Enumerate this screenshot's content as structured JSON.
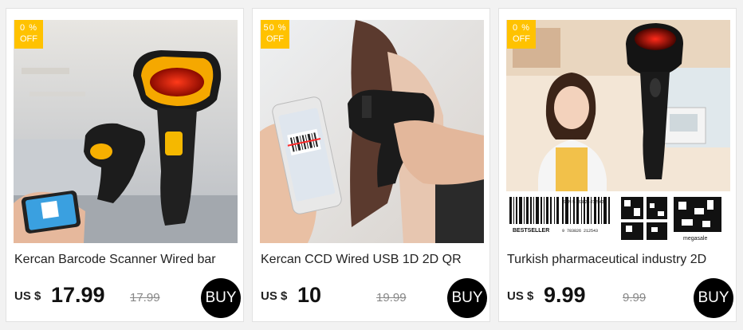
{
  "products": [
    {
      "title": "Kercan Barcode Scanner Wired bar",
      "discount": "0 %",
      "discount_suffix": "OFF",
      "currency": "US $",
      "price": "17.99",
      "old_price": "17.99",
      "buy_label": "BUY",
      "image": "barcode-scanner-photo"
    },
    {
      "title": "Kercan CCD Wired USB 1D 2D QR",
      "discount": "50 %",
      "discount_suffix": "OFF",
      "currency": "US $",
      "price": "10",
      "old_price": "19.99",
      "buy_label": "BUY",
      "image": "phone-scanning-photo"
    },
    {
      "title": "Turkish pharmaceutical industry 2D",
      "discount": "0 %",
      "discount_suffix": "OFF",
      "currency": "US $",
      "price": "9.99",
      "old_price": "9.99",
      "buy_label": "BUY",
      "image": "cashier-scanner-photo",
      "image_text": {
        "bestseller": "BESTSELLER",
        "megasale": "megasale",
        "isbn": "ISBN 9-783826-212543",
        "code": "9 783826 212543"
      }
    }
  ],
  "colors": {
    "badge": "#ffc200",
    "buy_button": "#000000"
  }
}
